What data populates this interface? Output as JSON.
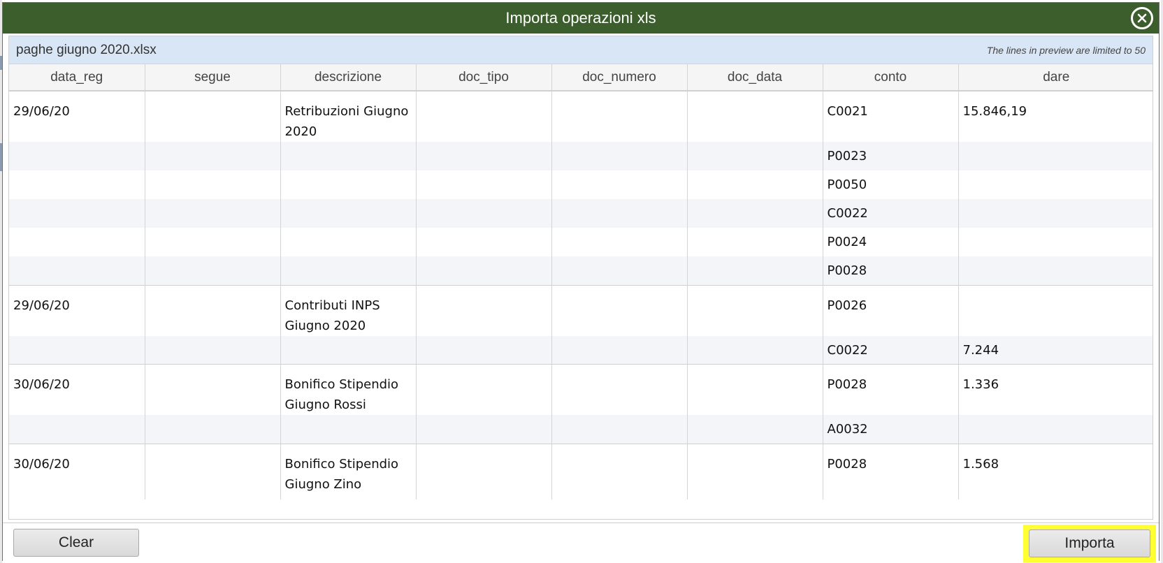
{
  "dialog": {
    "title": "Importa operazioni xls",
    "file_name": "paghe giugno 2020.xlsx",
    "preview_note": "The lines in preview are limited to 50"
  },
  "table": {
    "columns": [
      "data_reg",
      "segue",
      "descrizione",
      "doc_tipo",
      "doc_numero",
      "doc_data",
      "conto",
      "dare"
    ],
    "rows": [
      [
        "29/06/20",
        "",
        "Retribuzioni Giugno 2020",
        "",
        "",
        "",
        "C0021",
        "15.846,19"
      ],
      [
        "",
        "",
        "",
        "",
        "",
        "",
        "P0023",
        ""
      ],
      [
        "",
        "",
        "",
        "",
        "",
        "",
        "P0050",
        ""
      ],
      [
        "",
        "",
        "",
        "",
        "",
        "",
        "C0022",
        ""
      ],
      [
        "",
        "",
        "",
        "",
        "",
        "",
        "P0024",
        ""
      ],
      [
        "",
        "",
        "",
        "",
        "",
        "",
        "P0028",
        ""
      ],
      [
        "29/06/20",
        "",
        "Contributi INPS Giugno 2020",
        "",
        "",
        "",
        "P0026",
        ""
      ],
      [
        "",
        "",
        "",
        "",
        "",
        "",
        "C0022",
        "7.244"
      ],
      [
        "30/06/20",
        "",
        "Bonifico Stipendio Giugno Rossi",
        "",
        "",
        "",
        "P0028",
        "1.336"
      ],
      [
        "",
        "",
        "",
        "",
        "",
        "",
        "A0032",
        ""
      ],
      [
        "30/06/20",
        "",
        "Bonifico Stipendio Giugno Zino",
        "",
        "",
        "",
        "P0028",
        "1.568"
      ]
    ]
  },
  "footer": {
    "clear_label": "Clear",
    "importa_label": "Importa"
  },
  "colors": {
    "titlebar": "#3b5e2c",
    "info_bar": "#d9e6f5",
    "highlight": "#ffff33"
  },
  "icons": {
    "close": "close-circle-icon"
  }
}
